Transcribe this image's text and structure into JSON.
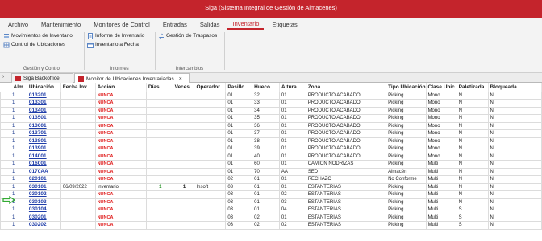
{
  "window": {
    "title": "Siga (Sistema Integral de Gestión de Almacenes)"
  },
  "menu": [
    "Archivo",
    "Mantenimiento",
    "Monitores de Control",
    "Entradas",
    "Salidas",
    "Inventario",
    "Etiquetas"
  ],
  "active_menu": "Inventario",
  "ribbon": {
    "groups": [
      {
        "label": "Gestión y Control",
        "buttons": [
          "Movimientos de Inventario",
          "Control de Ubicaciones"
        ]
      },
      {
        "label": "Informes",
        "buttons": [
          "Informe de Inventario",
          "Inventario a Fecha"
        ]
      },
      {
        "label": "Intercambios",
        "buttons": [
          "Gestión de Traspasos"
        ]
      }
    ]
  },
  "tabs": [
    "Siga Backoffice",
    "Monitor de Ubicaciones Inventariadas"
  ],
  "grid": {
    "columns": [
      "Alm",
      "Ubicación",
      "Fecha Inv.",
      "Acción",
      "Días",
      "Veces",
      "Operador",
      "Pasillo",
      "Hueco",
      "Altura",
      "Zona",
      "Tipo Ubicación",
      "Clase Ubic.",
      "Paletizada",
      "Bloqueada"
    ],
    "rows": [
      [
        "1",
        "013201",
        "",
        "NUNCA",
        "",
        "",
        "",
        "01",
        "32",
        "01",
        "PRODUCTO ACABADO",
        "Picking",
        "Mono",
        "N",
        "N"
      ],
      [
        "1",
        "013301",
        "",
        "NUNCA",
        "",
        "",
        "",
        "01",
        "33",
        "01",
        "PRODUCTO ACABADO",
        "Picking",
        "Mono",
        "N",
        "N"
      ],
      [
        "1",
        "013401",
        "",
        "NUNCA",
        "",
        "",
        "",
        "01",
        "34",
        "01",
        "PRODUCTO ACABADO",
        "Picking",
        "Mono",
        "N",
        "N"
      ],
      [
        "1",
        "013501",
        "",
        "NUNCA",
        "",
        "",
        "",
        "01",
        "35",
        "01",
        "PRODUCTO ACABADO",
        "Picking",
        "Mono",
        "N",
        "N"
      ],
      [
        "1",
        "013601",
        "",
        "NUNCA",
        "",
        "",
        "",
        "01",
        "36",
        "01",
        "PRODUCTO ACABADO",
        "Picking",
        "Mono",
        "N",
        "N"
      ],
      [
        "1",
        "013701",
        "",
        "NUNCA",
        "",
        "",
        "",
        "01",
        "37",
        "01",
        "PRODUCTO ACABADO",
        "Picking",
        "Mono",
        "N",
        "N"
      ],
      [
        "1",
        "013801",
        "",
        "NUNCA",
        "",
        "",
        "",
        "01",
        "38",
        "01",
        "PRODUCTO ACABADO",
        "Picking",
        "Mono",
        "N",
        "N"
      ],
      [
        "1",
        "013901",
        "",
        "NUNCA",
        "",
        "",
        "",
        "01",
        "39",
        "01",
        "PRODUCTO ACABADO",
        "Picking",
        "Mono",
        "N",
        "N"
      ],
      [
        "1",
        "014001",
        "",
        "NUNCA",
        "",
        "",
        "",
        "01",
        "40",
        "01",
        "PRODUCTO ACABADO",
        "Picking",
        "Mono",
        "N",
        "N"
      ],
      [
        "1",
        "016001",
        "",
        "NUNCA",
        "",
        "",
        "",
        "01",
        "60",
        "01",
        "CAMION NODRIZAS",
        "Picking",
        "Multi",
        "N",
        "N"
      ],
      [
        "1",
        "0170AA",
        "",
        "NUNCA",
        "",
        "",
        "",
        "01",
        "70",
        "AA",
        "SED",
        "Almacén",
        "Multi",
        "N",
        "N"
      ],
      [
        "1",
        "020101",
        "",
        "NUNCA",
        "",
        "",
        "",
        "02",
        "01",
        "01",
        "RECHAZO",
        "No Conforme",
        "Multi",
        "N",
        "N"
      ],
      [
        "1",
        "030101",
        "06/09/2022",
        "Inventario",
        "1",
        "1",
        "Insoft",
        "03",
        "01",
        "01",
        "ESTANTERIAS",
        "Picking",
        "Multi",
        "N",
        "N"
      ],
      [
        "1",
        "030102",
        "",
        "NUNCA",
        "",
        "",
        "",
        "03",
        "01",
        "02",
        "ESTANTERIAS",
        "Picking",
        "Multi",
        "N",
        "N"
      ],
      [
        "1",
        "030103",
        "",
        "NUNCA",
        "",
        "",
        "",
        "03",
        "01",
        "03",
        "ESTANTERIAS",
        "Picking",
        "Multi",
        "N",
        "N"
      ],
      [
        "1",
        "030104",
        "",
        "NUNCA",
        "",
        "",
        "",
        "03",
        "01",
        "04",
        "ESTANTERIAS",
        "Picking",
        "Multi",
        "S",
        "N"
      ],
      [
        "1",
        "030201",
        "",
        "NUNCA",
        "",
        "",
        "",
        "03",
        "02",
        "01",
        "ESTANTERIAS",
        "Picking",
        "Multi",
        "S",
        "N"
      ],
      [
        "1",
        "030202",
        "",
        "NUNCA",
        "",
        "",
        "",
        "03",
        "02",
        "02",
        "ESTANTERIAS",
        "Picking",
        "Multi",
        "S",
        "N"
      ]
    ],
    "current_row": 12
  },
  "colors": {
    "accent": "#c4242c",
    "link": "#1e3ca8",
    "never": "#e02020",
    "days": "#209020",
    "arrow": "#33aa33"
  }
}
